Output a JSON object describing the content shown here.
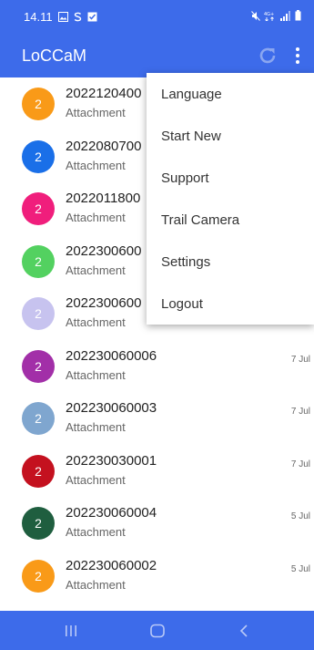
{
  "status_bar": {
    "time": "14.11",
    "left_icons": [
      "gallery-icon",
      "s-icon",
      "check-icon"
    ],
    "right_icons": [
      "mute-icon",
      "network-icon",
      "signal-icon",
      "battery-icon"
    ]
  },
  "app_bar": {
    "title": "LoCCaM",
    "refresh_icon": "refresh-icon",
    "more_icon": "more-vert-icon"
  },
  "list": [
    {
      "badge": "2",
      "title": "2022120400",
      "subtitle": "Attachment",
      "date": "",
      "color": "#f99a18"
    },
    {
      "badge": "2",
      "title": "2022080700",
      "subtitle": "Attachment",
      "date": "",
      "color": "#1a6fe8"
    },
    {
      "badge": "2",
      "title": "2022011800",
      "subtitle": "Attachment",
      "date": "",
      "color": "#f01e7c"
    },
    {
      "badge": "2",
      "title": "2022300600",
      "subtitle": "Attachment",
      "date": "",
      "color": "#53d160"
    },
    {
      "badge": "2",
      "title": "2022300600",
      "subtitle": "Attachment",
      "date": "",
      "color": "#c7c3ef"
    },
    {
      "badge": "2",
      "title": "202230060006",
      "subtitle": "Attachment",
      "date": "7 Jul",
      "color": "#a22fa8"
    },
    {
      "badge": "2",
      "title": "202230060003",
      "subtitle": "Attachment",
      "date": "7 Jul",
      "color": "#7fa6cf"
    },
    {
      "badge": "2",
      "title": "202230030001",
      "subtitle": "Attachment",
      "date": "7 Jul",
      "color": "#c4111f"
    },
    {
      "badge": "2",
      "title": "202230060004",
      "subtitle": "Attachment",
      "date": "5 Jul",
      "color": "#1f5e3f"
    },
    {
      "badge": "2",
      "title": "202230060002",
      "subtitle": "Attachment",
      "date": "5 Jul",
      "color": "#f99a18"
    },
    {
      "badge": "",
      "title": "",
      "subtitle": "",
      "date": "",
      "color": "#1a6fe8"
    }
  ],
  "menu": {
    "items": [
      "Language",
      "Start New",
      "Support",
      "Trail Camera",
      "Settings",
      "Logout"
    ]
  },
  "nav_bar": {
    "icons": [
      "recent-apps-icon",
      "home-icon",
      "back-icon"
    ]
  },
  "colors": {
    "primary": "#3d6bea",
    "text_primary": "#222222",
    "text_secondary": "#666666"
  }
}
